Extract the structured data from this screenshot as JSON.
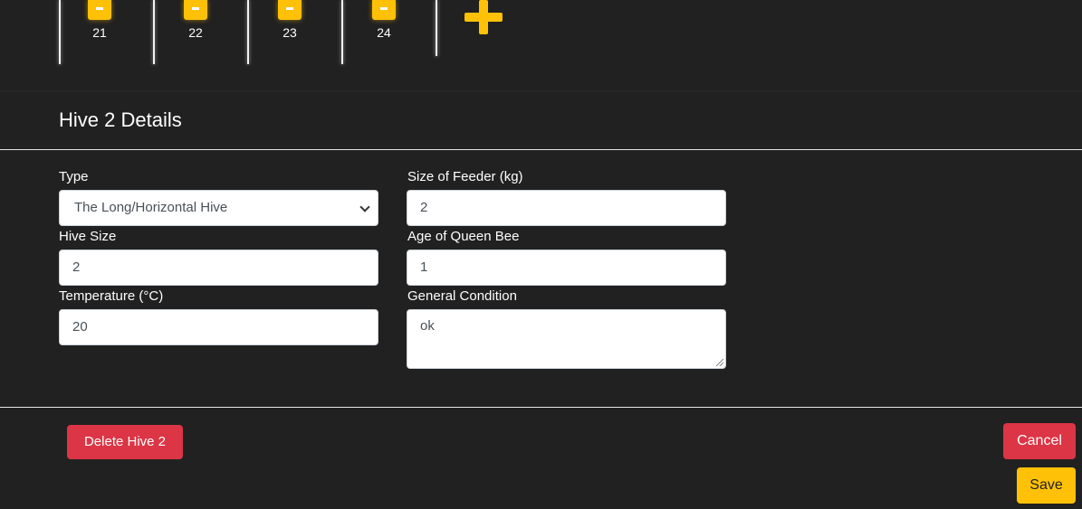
{
  "hive_strip": {
    "hives": [
      {
        "number": "21"
      },
      {
        "number": "22"
      },
      {
        "number": "23"
      },
      {
        "number": "24"
      }
    ]
  },
  "details": {
    "title": "Hive 2 Details",
    "fields": {
      "type": {
        "label": "Type",
        "value": "The Long/Horizontal Hive"
      },
      "feeder_size": {
        "label": "Size of Feeder (kg)",
        "value": "2"
      },
      "hive_size": {
        "label": "Hive Size",
        "value": "2"
      },
      "queen_age": {
        "label": "Age of Queen Bee",
        "value": "1"
      },
      "temperature": {
        "label": "Temperature (°C)",
        "value": "20"
      },
      "general_condition": {
        "label": "General Condition",
        "value": "ok"
      }
    }
  },
  "footer": {
    "delete_label": "Delete Hive 2",
    "cancel_label": "Cancel",
    "save_label": "Save"
  },
  "colors": {
    "background": "#212121",
    "accent_yellow": "#ffc107",
    "danger_red": "#dc3545"
  }
}
